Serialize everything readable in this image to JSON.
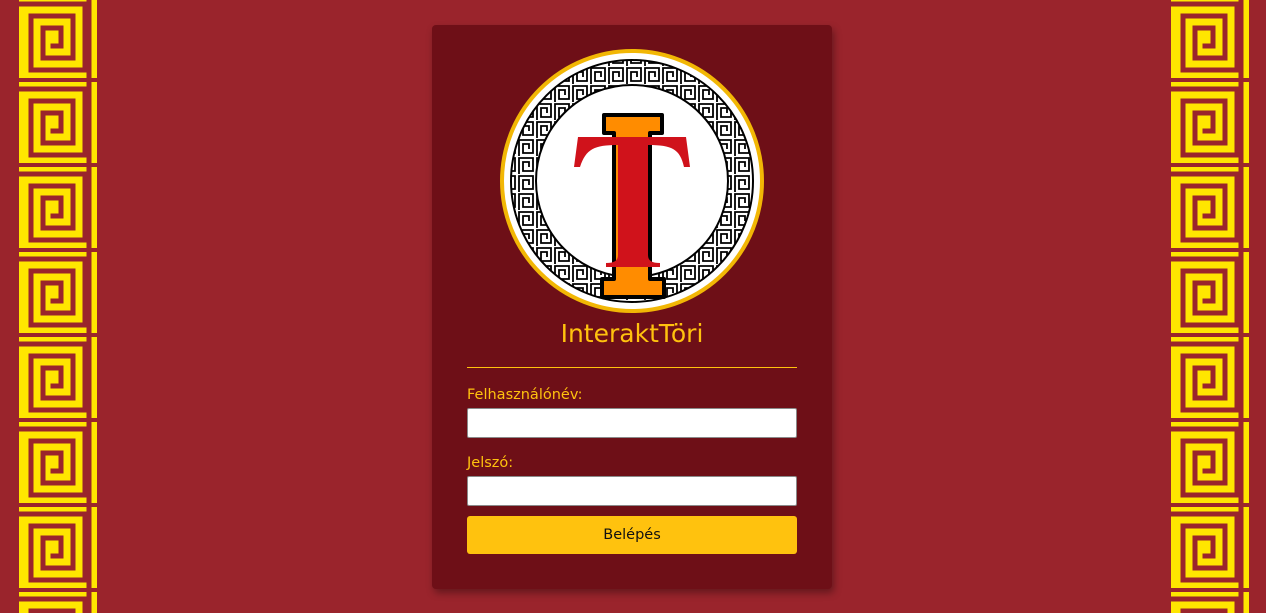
{
  "app": {
    "title": "InteraktTöri"
  },
  "form": {
    "username_label": "Felhasználónév:",
    "username_value": "",
    "password_label": "Jelszó:",
    "password_value": "",
    "login_button": "Belépés"
  },
  "colors": {
    "background": "#9a242c",
    "card": "#6e0f17",
    "accent": "#ffc20e",
    "logo_letter": "#d0121b",
    "logo_column": "#ff8c00"
  },
  "icons": {
    "logo": "greek-meander-circle-t-logo",
    "side_border": "greek-key-meander-border"
  }
}
